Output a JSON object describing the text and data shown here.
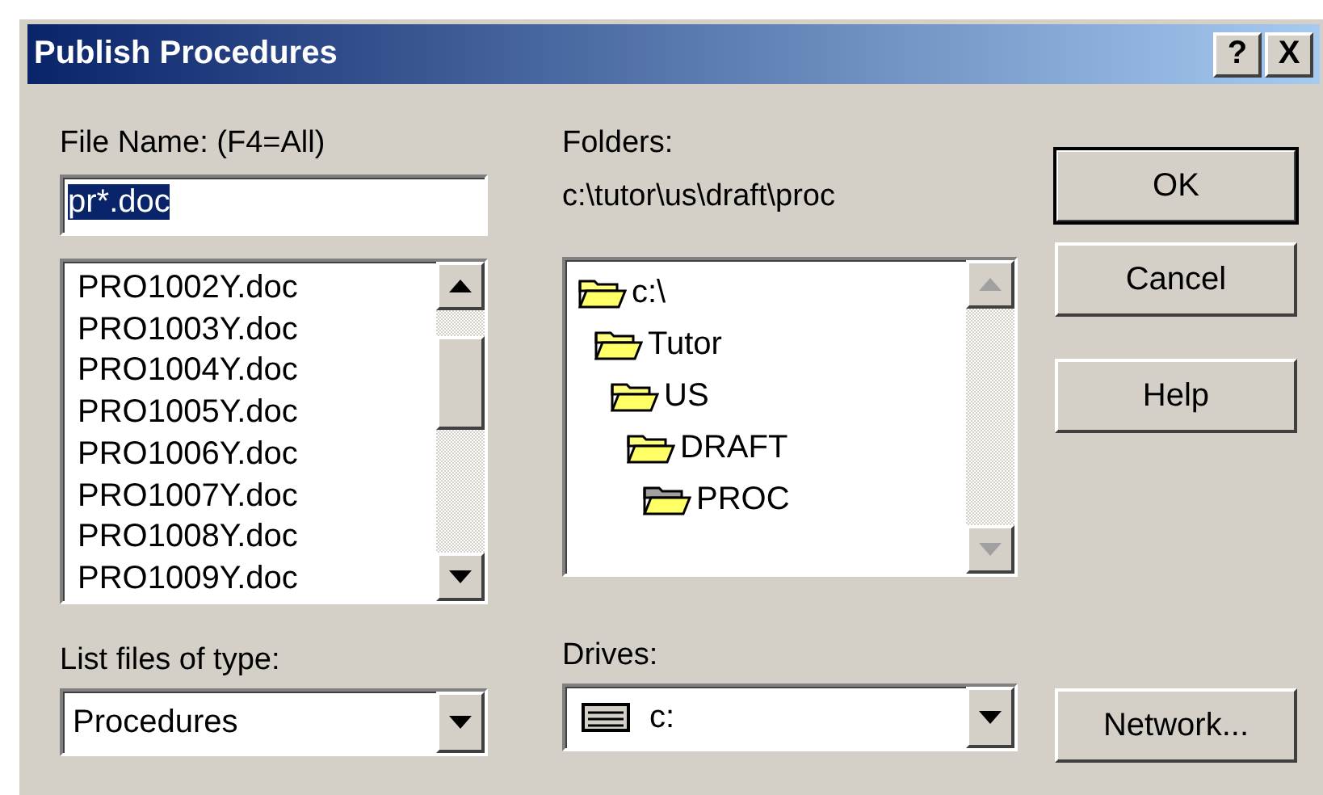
{
  "window": {
    "title": "Publish Procedures",
    "title_buttons": [
      {
        "label": "?"
      },
      {
        "label": "X"
      }
    ]
  },
  "file_name": {
    "label": "File Name: (F4=All)",
    "value": "pr*.doc",
    "text_selected": true
  },
  "files": [
    {
      "name": "PRO1002Y.doc"
    },
    {
      "name": "PRO1003Y.doc"
    },
    {
      "name": "PRO1004Y.doc"
    },
    {
      "name": "PRO1005Y.doc"
    },
    {
      "name": "PRO1006Y.doc"
    },
    {
      "name": "PRO1007Y.doc"
    },
    {
      "name": "PRO1008Y.doc"
    },
    {
      "name": "PRO1009Y.doc"
    }
  ],
  "folders": {
    "label": "Folders:",
    "path": "c:\\tutor\\us\\draft\\proc",
    "tree": [
      {
        "name": "c:\\",
        "selected": false,
        "children": [
          {
            "name": "Tutor",
            "selected": false,
            "children": [
              {
                "name": "US",
                "selected": false,
                "children": [
                  {
                    "name": "DRAFT",
                    "selected": false,
                    "children": [
                      {
                        "name": "PROC",
                        "selected": true
                      }
                    ]
                  }
                ]
              }
            ]
          }
        ]
      }
    ],
    "scroll_disabled": true
  },
  "file_type": {
    "label": "List files of type:",
    "value": "Procedures"
  },
  "drives": {
    "label": "Drives:",
    "value": "c:"
  },
  "buttons": [
    {
      "label": "OK",
      "default": true
    },
    {
      "label": "Cancel",
      "default": false
    },
    {
      "label": "Help",
      "default": false
    }
  ],
  "network_button": {
    "label": "Network..."
  }
}
